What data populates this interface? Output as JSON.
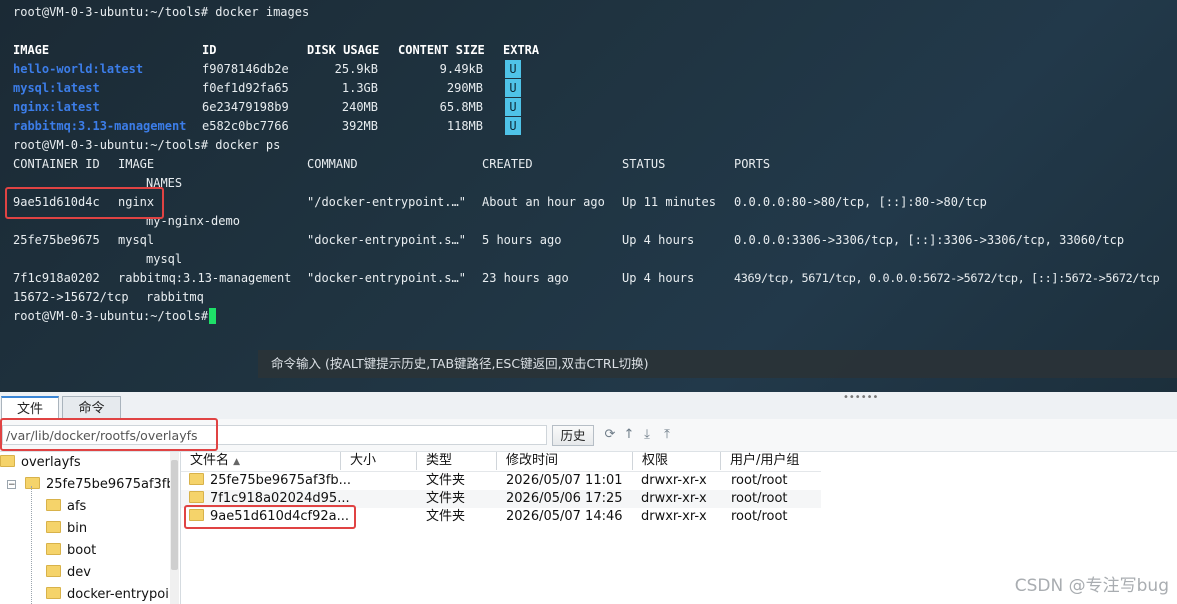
{
  "terminal": {
    "prompt1": "root@VM-0-3-ubuntu:~/tools# docker images",
    "images_headers": [
      "IMAGE",
      "ID",
      "DISK USAGE",
      "CONTENT SIZE",
      "EXTRA"
    ],
    "images": [
      {
        "name": "hello-world:latest",
        "id": "f9078146db2e",
        "disk": "25.9kB",
        "content": "9.49kB",
        "extra": "U"
      },
      {
        "name": "mysql:latest",
        "id": "f0ef1d92fa65",
        "disk": "1.3GB",
        "content": "290MB",
        "extra": "U"
      },
      {
        "name": "nginx:latest",
        "id": "6e23479198b9",
        "disk": "240MB",
        "content": "65.8MB",
        "extra": "U"
      },
      {
        "name": "rabbitmq:3.13-management",
        "id": "e582c0bc7766",
        "disk": "392MB",
        "content": "118MB",
        "extra": "U"
      }
    ],
    "prompt2": "root@VM-0-3-ubuntu:~/tools# docker ps",
    "ps_headers": {
      "container_id": "CONTAINER ID",
      "image": "IMAGE",
      "command": "COMMAND",
      "created": "CREATED",
      "status": "STATUS",
      "ports": "PORTS",
      "names": "NAMES"
    },
    "containers": [
      {
        "id": "9ae51d610d4c",
        "image": "nginx",
        "command": "\"/docker-entrypoint.…\"",
        "created": "About an hour ago",
        "status": "Up 11 minutes",
        "ports": "0.0.0.0:80->80/tcp, [::]:80->80/tcp",
        "name": "my-nginx-demo"
      },
      {
        "id": "25fe75be9675",
        "image": "mysql",
        "command": "\"docker-entrypoint.s…\"",
        "created": "5 hours ago",
        "status": "Up 4 hours",
        "ports": "0.0.0.0:3306->3306/tcp, [::]:3306->3306/tcp, 33060/tcp",
        "name": "mysql"
      },
      {
        "id": "7f1c918a0202",
        "image": "rabbitmq:3.13-management",
        "command": "\"docker-entrypoint.s…\"",
        "created": "23 hours ago",
        "status": "Up 4 hours",
        "ports": "4369/tcp, 5671/tcp, 0.0.0.0:5672->5672/tcp, [::]:5672->5672/tcp",
        "ports_cont": "15672->15672/tcp",
        "name": "rabbitmq"
      }
    ],
    "prompt3": "root@VM-0-3-ubuntu:~/tools# ",
    "cmd_hint": "命令输入 (按ALT键提示历史,TAB键路径,ESC键返回,双击CTRL切换)",
    "colors": {
      "accent_red": "#e04343",
      "image_name": "#3c7de8",
      "badge": "#4fc3e8",
      "cursor": "#1ee068"
    }
  },
  "filemanager": {
    "tabs": [
      "文件",
      "命令"
    ],
    "path": "/var/lib/docker/rootfs/overlayfs",
    "history_btn": "历史",
    "tree": {
      "root": "overlayfs",
      "child": "25fe75be9675af3fb'",
      "items": [
        "afs",
        "bin",
        "boot",
        "dev",
        "docker-entrypoi"
      ]
    },
    "columns": [
      "文件名",
      "大小",
      "类型",
      "修改时间",
      "权限",
      "用户/用户组"
    ],
    "files": [
      {
        "name": "25fe75be9675af3fb...",
        "size": "",
        "type": "文件夹",
        "mtime": "2026/05/07 11:01",
        "perm": "drwxr-xr-x",
        "owner": "root/root"
      },
      {
        "name": "7f1c918a02024d95...",
        "size": "",
        "type": "文件夹",
        "mtime": "2026/05/06 17:25",
        "perm": "drwxr-xr-x",
        "owner": "root/root"
      },
      {
        "name": "9ae51d610d4cf92a...",
        "size": "",
        "type": "文件夹",
        "mtime": "2026/05/07 14:46",
        "perm": "drwxr-xr-x",
        "owner": "root/root"
      }
    ]
  },
  "watermark": "CSDN @专注写bug"
}
